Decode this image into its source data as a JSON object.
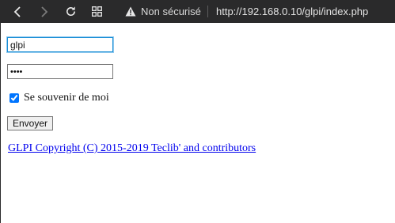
{
  "browser": {
    "security_label": "Non sécurisé",
    "url": "http://192.168.0.10/glpi/index.php",
    "icons": {
      "back": "back-arrow-icon",
      "forward": "forward-arrow-icon",
      "reload": "reload-icon",
      "apps": "apps-grid-icon",
      "security": "warning-triangle-icon"
    }
  },
  "login_form": {
    "login_value": "glpi",
    "password_value": "••••",
    "remember_label": "Se souvenir de moi",
    "remember_checked": true,
    "submit_label": "Envoyer"
  },
  "footer": {
    "copyright_text": "GLPI Copyright (C) 2015-2019 Teclib' and contributors"
  },
  "colors": {
    "toolbar_bg": "#2a2a2b",
    "link": "#0000ee",
    "focus_border": "#1a8fd6"
  }
}
